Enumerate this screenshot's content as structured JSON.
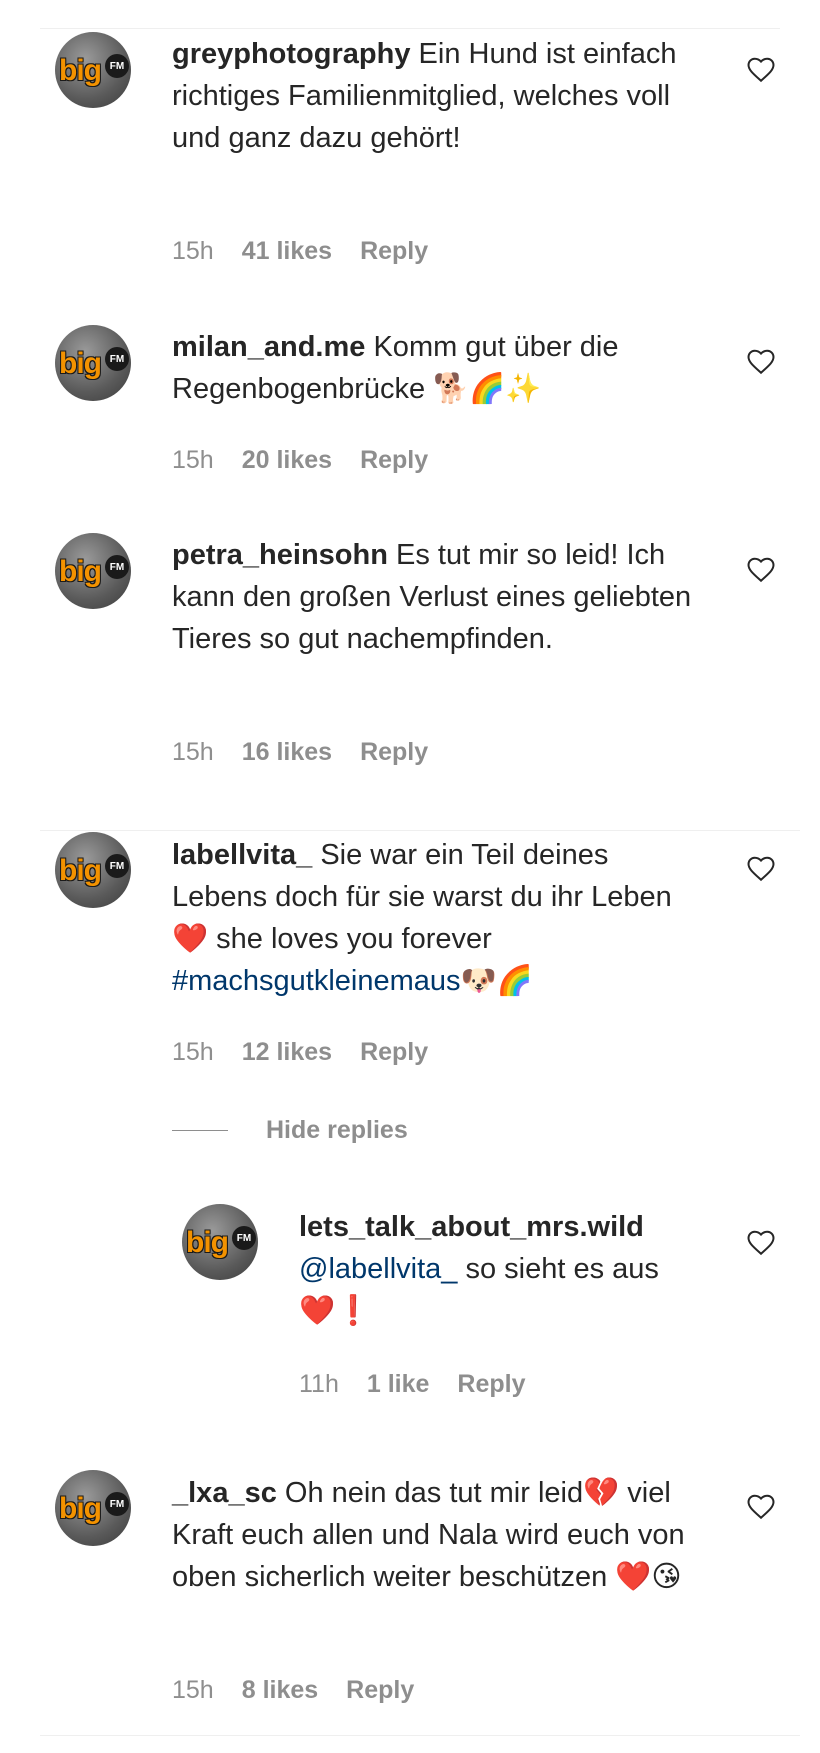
{
  "comments": [
    {
      "username": "greyphotography",
      "text": "Ein Hund ist einfach richtiges Familienmitglied, welches voll und ganz dazu gehört!",
      "time": "15h",
      "likes": "41 likes",
      "reply": "Reply"
    },
    {
      "username": "milan_and.me",
      "text": "Komm gut über die Regenbogenbrücke 🐕🌈✨",
      "time": "15h",
      "likes": "20 likes",
      "reply": "Reply"
    },
    {
      "username": "petra_heinsohn",
      "text": "Es tut mir so leid! Ich kann den großen Verlust eines geliebten Tieres so gut nachempfinden.",
      "time": "15h",
      "likes": "16 likes",
      "reply": "Reply"
    },
    {
      "username": "labellvita_",
      "text": "Sie war ein Teil deines Lebens doch für sie warst du ihr Leben ❤️ she loves you forever",
      "hashtag": "#machsgutkleinemaus🐶🌈",
      "time": "15h",
      "likes": "12 likes",
      "reply": "Reply",
      "hide_replies": "Hide replies"
    },
    {
      "username": "lets_talk_about_mrs.wild",
      "mention": "@labellvita_",
      "text": "so sieht es aus ❤️❗",
      "time": "11h",
      "likes": "1 like",
      "reply": "Reply"
    },
    {
      "username": "_lxa_sc",
      "text": "Oh nein das tut mir leid💔 viel Kraft euch allen und Nala wird euch von oben sicherlich weiter beschützen ❤️😘",
      "time": "15h",
      "likes": "8 likes",
      "reply": "Reply"
    }
  ],
  "avatar_brand": "big",
  "avatar_fm": "FM",
  "icons": {
    "like": "heart-outline-icon"
  },
  "colors": {
    "text": "#262626",
    "meta": "#8e8e8e",
    "link": "#00376b",
    "brand": "#f39200"
  }
}
